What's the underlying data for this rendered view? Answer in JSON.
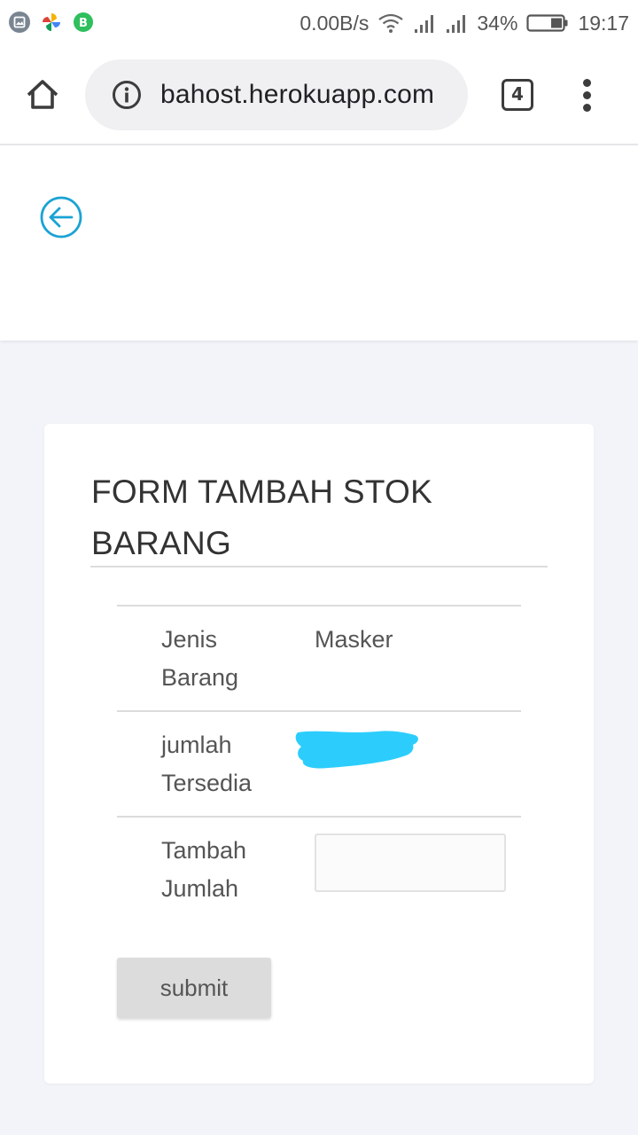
{
  "status_bar": {
    "net_speed": "0.00B/s",
    "battery": "34%",
    "time": "19:17",
    "icons": [
      "gallery-notification-icon",
      "pinwheel-app-icon",
      "whatsapp-business-icon",
      "wifi-icon",
      "signal-icon",
      "signal-icon",
      "battery-icon"
    ]
  },
  "browser": {
    "url": "bahost.herokuapp.com",
    "tab_count": "4",
    "icons": [
      "home-icon",
      "info-icon",
      "tabs-icon",
      "more-vert-icon"
    ]
  },
  "header": {
    "back_icon": "arrow-left-circle-icon",
    "accent_color": "#1aa3d4"
  },
  "form": {
    "title": "FORM TAMBAH STOK BARANG",
    "rows": [
      {
        "label": "Jenis Barang",
        "value": "Masker"
      },
      {
        "label": "jumlah Tersedia",
        "value": ""
      },
      {
        "label": "Tambah Jumlah",
        "input_value": ""
      }
    ],
    "submit_label": "submit",
    "redaction_color": "#2ccdfc"
  }
}
